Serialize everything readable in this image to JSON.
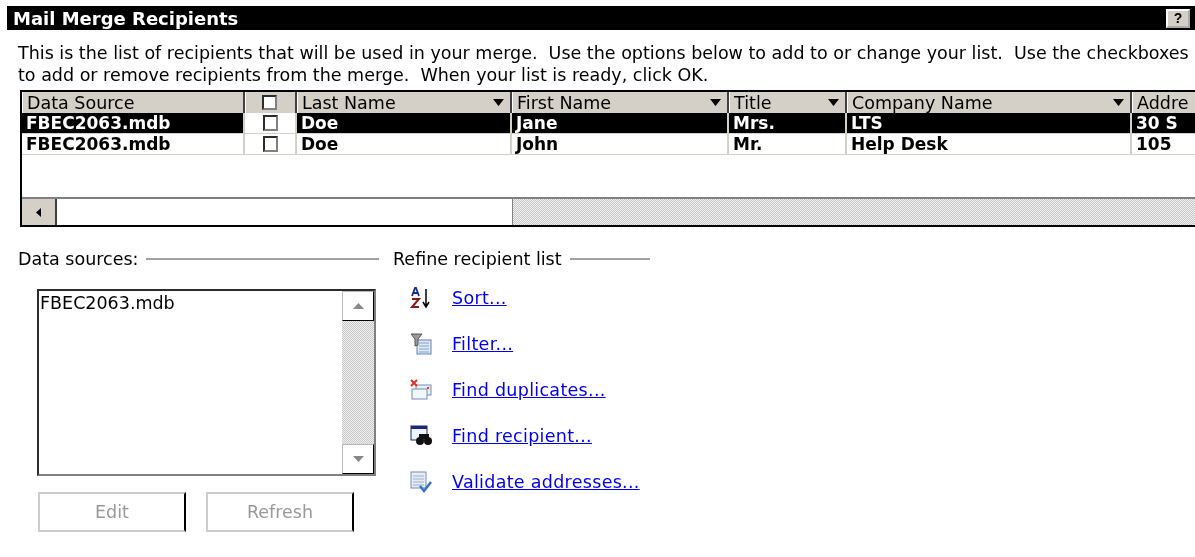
{
  "window": {
    "title": "Mail Merge Recipients",
    "help_button": "?"
  },
  "description": "This is the list of recipients that will be used in your merge.  Use the options below to add to or change your list.  Use the checkboxes to add or remove recipients from the merge.  When your list is ready, click OK.",
  "table": {
    "columns": [
      {
        "label": "Data Source",
        "kind": "text",
        "dropdown": false
      },
      {
        "kind": "checkbox",
        "checked": false
      },
      {
        "label": "Last Name",
        "kind": "text",
        "dropdown": true
      },
      {
        "label": "First Name",
        "kind": "text",
        "dropdown": true
      },
      {
        "label": "Title",
        "kind": "text",
        "dropdown": true
      },
      {
        "label": "Company Name",
        "kind": "text",
        "dropdown": true
      },
      {
        "label": "Addre",
        "kind": "text",
        "dropdown": false
      }
    ],
    "rows": [
      {
        "selected": true,
        "checked": false,
        "cells": [
          "FBEC2063.mdb",
          "",
          "Doe",
          "Jane",
          "Mrs.",
          "LTS",
          "30 S"
        ]
      },
      {
        "selected": false,
        "checked": false,
        "cells": [
          "FBEC2063.mdb",
          "",
          "Doe",
          "John",
          "Mr.",
          "Help Desk",
          "105"
        ]
      }
    ]
  },
  "data_sources": {
    "label": "Data sources:",
    "items": [
      "FBEC2063.mdb"
    ],
    "buttons": [
      {
        "label": "Edit",
        "disabled": true
      },
      {
        "label": "Refresh",
        "disabled": true
      }
    ]
  },
  "refine": {
    "label": "Refine recipient list",
    "links": [
      {
        "kind": "sort",
        "label": "Sort..."
      },
      {
        "kind": "filter",
        "label": "Filter..."
      },
      {
        "kind": "duplicates",
        "label": "Find duplicates..."
      },
      {
        "kind": "find",
        "label": "Find recipient..."
      },
      {
        "kind": "validate",
        "label": "Validate addresses..."
      }
    ]
  }
}
